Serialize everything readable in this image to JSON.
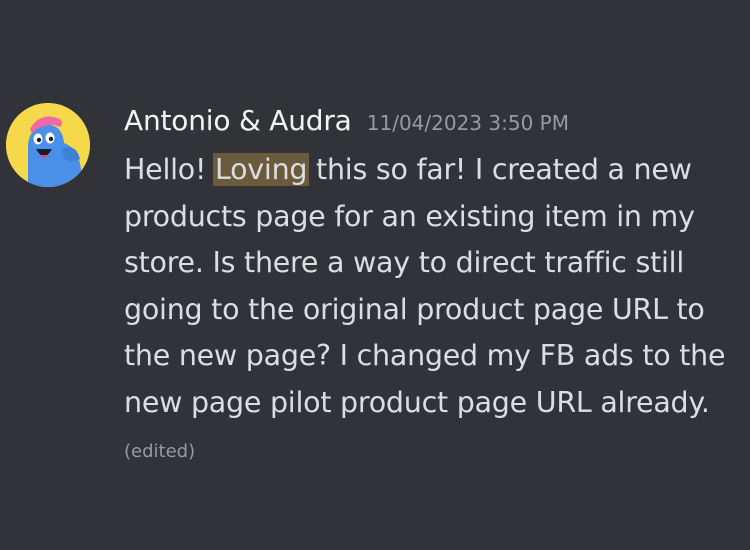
{
  "message": {
    "author": "Antonio & Audra",
    "timestamp": "11/04/2023 3:50 PM",
    "lines": [
      {
        "before": "Hello!  ",
        "highlight": "Loving",
        "after": " this so far!  I created a new"
      },
      {
        "text": "products page for an existing item in my"
      },
      {
        "text": "store.  Is there a way to direct traffic still"
      },
      {
        "text": "going to the original product page URL to"
      },
      {
        "text": "the new page?  I changed my FB ads to the"
      },
      {
        "text": "new page pilot product page URL already."
      }
    ],
    "edited_label": "(edited)"
  },
  "avatar": {
    "icon": "blue-mascot-avatar-icon",
    "background_color": "#f5d94a",
    "mascot_color": "#4a8fe8",
    "hat_color": "#f06aa8"
  },
  "colors": {
    "background": "#313338",
    "text": "#dbdee1",
    "author": "#f2f3f5",
    "muted": "#949ba4",
    "highlight": "#6b5a3c"
  }
}
